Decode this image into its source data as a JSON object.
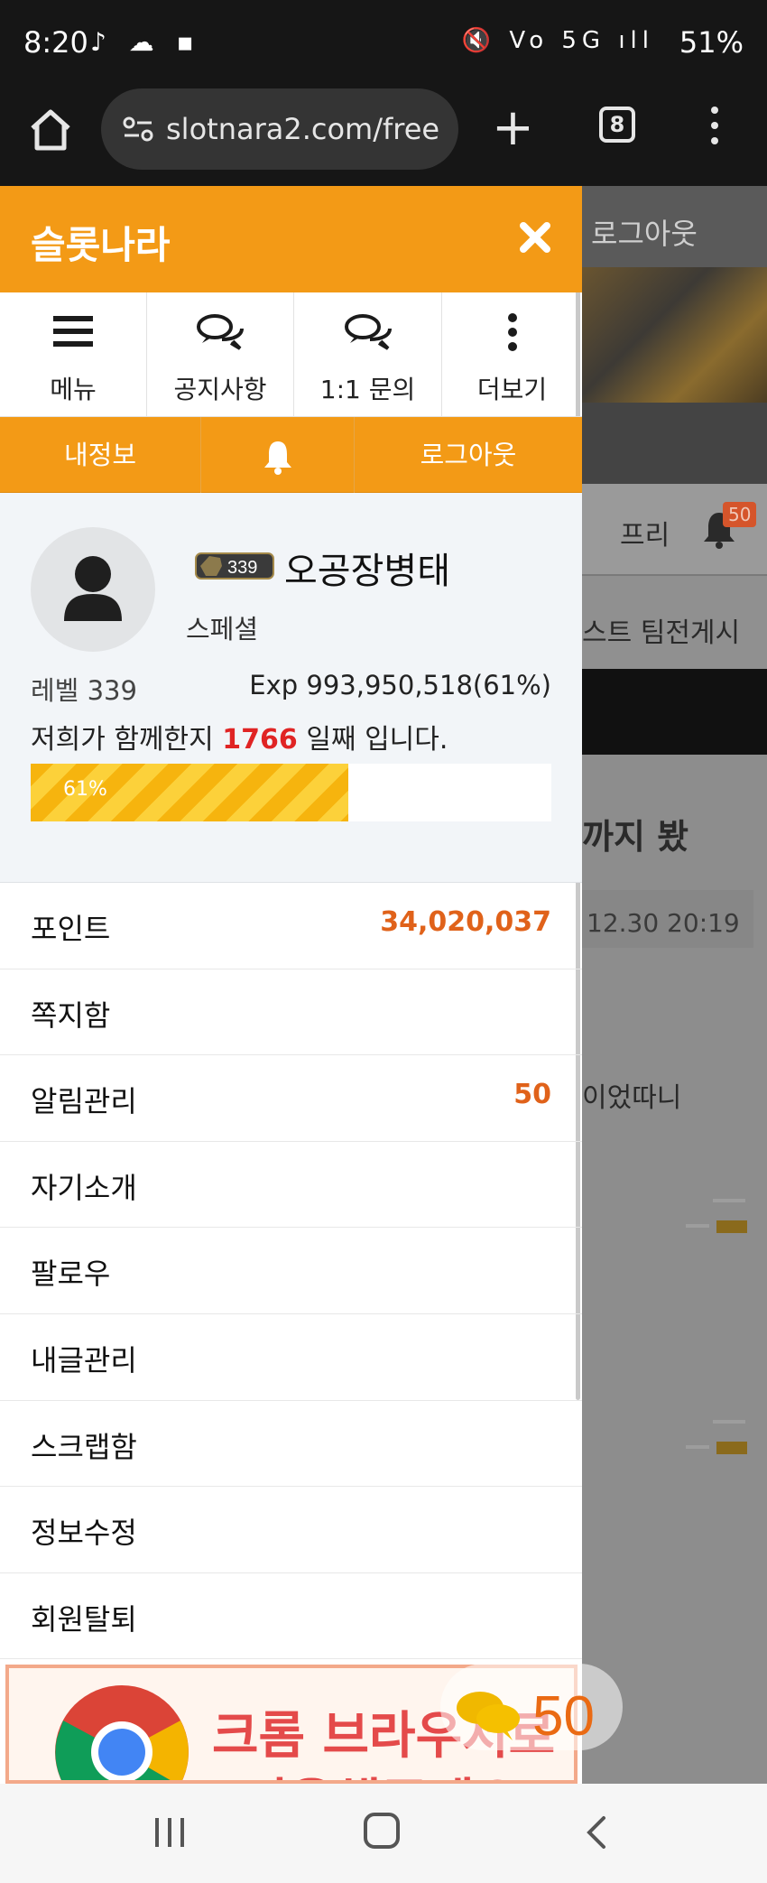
{
  "status": {
    "time": "8:20",
    "left_icons": "♪ ☁ ▪",
    "right_icons": "🔇 Vo 5G ıll",
    "battery": "51%"
  },
  "browser": {
    "url": "slotnara2.com/free",
    "tab_count": "8"
  },
  "background_page": {
    "header_logout": "로그아웃",
    "tab_partial": "프리",
    "notification_count": "50",
    "tabs_partial": "스트   팀전게시",
    "post_title_partial": "까지 봤",
    "post_date_partial": "12.30 20:19",
    "post_body_partial": "이었따니",
    "chat_count": "50"
  },
  "drawer": {
    "title": "슬롯나라",
    "quick_menu": [
      {
        "label": "메뉴",
        "icon": "menu-icon"
      },
      {
        "label": "공지사항",
        "icon": "chat-icon"
      },
      {
        "label": "1:1 문의",
        "icon": "chat-icon"
      },
      {
        "label": "더보기",
        "icon": "more-icon"
      }
    ],
    "user_bar": {
      "my_info": "내정보",
      "logout": "로그아웃"
    },
    "profile": {
      "level_badge": "339",
      "nickname": "오공장병태",
      "grade": "스페셜",
      "level_text": "레벨 339",
      "exp_text": "Exp 993,950,518(61%)",
      "days_prefix": "저희가 함께한지",
      "days_value": "1766",
      "days_suffix": "일째 입니다.",
      "progress_label": "61%",
      "progress": 0.61
    },
    "menu_items": [
      {
        "label": "포인트",
        "value": "34,020,037"
      },
      {
        "label": "쪽지함",
        "value": ""
      },
      {
        "label": "알림관리",
        "value": "50"
      },
      {
        "label": "자기소개",
        "value": ""
      },
      {
        "label": "팔로우",
        "value": ""
      },
      {
        "label": "내글관리",
        "value": ""
      },
      {
        "label": "스크랩함",
        "value": ""
      },
      {
        "label": "정보수정",
        "value": ""
      },
      {
        "label": "회원탈퇴",
        "value": ""
      }
    ],
    "ad": {
      "line1": "크롬 브라우저로",
      "line2": "이용해주세요!",
      "chat_count": "50"
    }
  },
  "colors": {
    "brand_orange": "#f39a16",
    "accent_red": "#e02424",
    "value_orange": "#e0621a"
  }
}
